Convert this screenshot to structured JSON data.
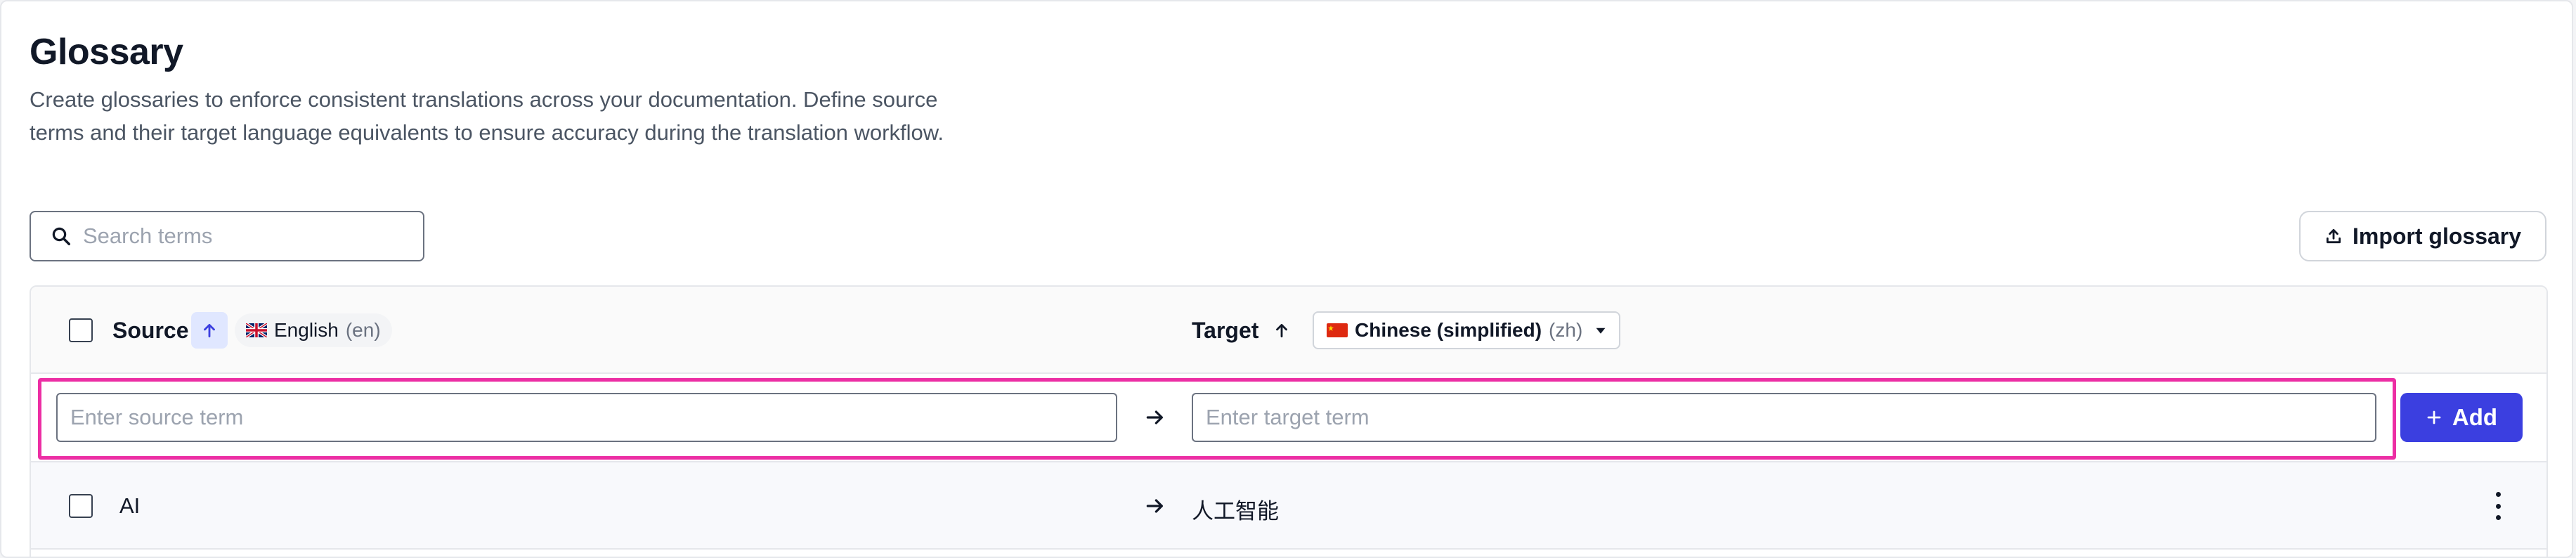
{
  "page": {
    "title": "Glossary",
    "description": "Create glossaries to enforce consistent translations across your documentation. Define source terms and their target language equivalents to ensure accuracy during the translation workflow."
  },
  "search": {
    "placeholder": "Search terms",
    "icon": "search-icon"
  },
  "import_button": {
    "label": "Import glossary",
    "icon": "upload-icon"
  },
  "table": {
    "source_header": "Source",
    "target_header": "Target",
    "source_language": {
      "name": "English",
      "code": "(en)",
      "flag": "uk-flag-icon"
    },
    "target_language": {
      "name": "Chinese (simplified)",
      "code": "(zh)",
      "flag": "china-flag-icon"
    },
    "sort_icon": "arrow-up-icon"
  },
  "new_entry": {
    "source_placeholder": "Enter source term",
    "target_placeholder": "Enter target term",
    "add_label": "Add"
  },
  "rows": [
    {
      "source": "AI",
      "target": "人工智能"
    }
  ],
  "colors": {
    "accent": "#3b3fe0",
    "highlight": "#ec2ea4",
    "sort_active_bg": "#e0e7ff"
  }
}
